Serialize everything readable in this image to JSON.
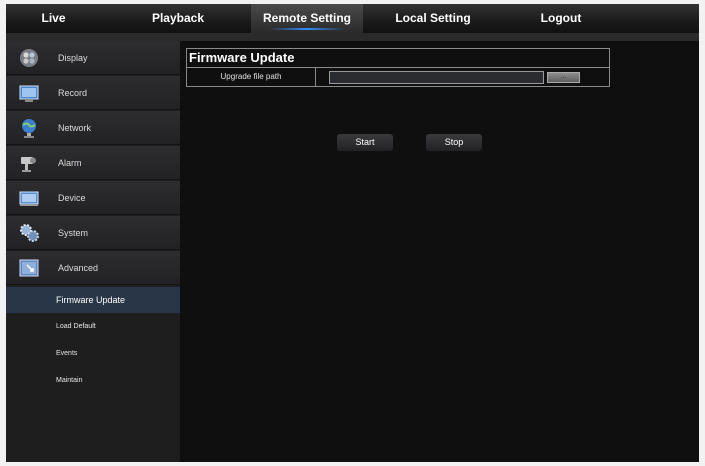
{
  "nav": [
    {
      "label": "Live",
      "active": false
    },
    {
      "label": "Playback",
      "active": false
    },
    {
      "label": "Remote Setting",
      "active": true
    },
    {
      "label": "Local Setting",
      "active": false
    },
    {
      "label": "Logout",
      "active": false
    }
  ],
  "sidebar": {
    "items": [
      {
        "label": "Display",
        "icon": "display-icon"
      },
      {
        "label": "Record",
        "icon": "record-icon"
      },
      {
        "label": "Network",
        "icon": "network-icon"
      },
      {
        "label": "Alarm",
        "icon": "alarm-icon"
      },
      {
        "label": "Device",
        "icon": "device-icon"
      },
      {
        "label": "System",
        "icon": "system-icon"
      },
      {
        "label": "Advanced",
        "icon": "advanced-icon"
      }
    ],
    "subitems": [
      {
        "label": "Firmware Update",
        "active": true
      },
      {
        "label": "Load Default",
        "active": false
      },
      {
        "label": "Events",
        "active": false
      },
      {
        "label": "Maintain",
        "active": false
      }
    ]
  },
  "firmware": {
    "title": "Firmware Update",
    "path_label": "Upgrade file path",
    "path_value": "",
    "browse_label": "...",
    "start_label": "Start",
    "stop_label": "Stop"
  },
  "colors": {
    "accent": "#2f8cff",
    "active_subitem": "#283648",
    "background": "#0f0f10"
  }
}
